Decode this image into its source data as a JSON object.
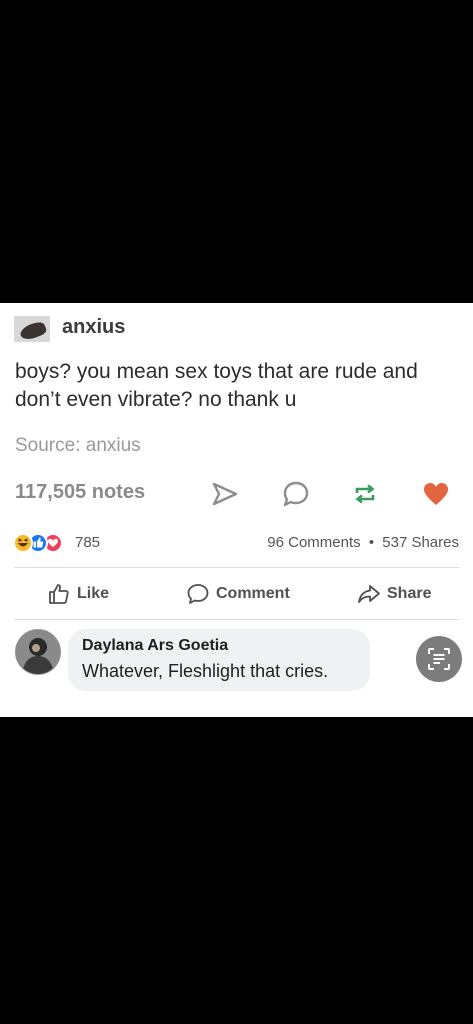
{
  "tumblr": {
    "username": "anxius",
    "post_text": "boys? you mean sex toys that are rude and don’t even vibrate? no thank u",
    "source": "Source: anxius",
    "notes": "117,505 notes"
  },
  "facebook": {
    "reaction_count": "785",
    "comments_count": "96 Comments",
    "separator": "•",
    "shares_count": "537 Shares",
    "like_label": "Like",
    "comment_label": "Comment",
    "share_label": "Share"
  },
  "comment": {
    "author": "Daylana Ars Goetia",
    "text": "Whatever, Fleshlight that cries."
  },
  "icons": {
    "send": "send-icon",
    "reply": "reply-icon",
    "reblog": "reblog-icon",
    "heart": "heart-icon",
    "like": "thumbs-up-icon",
    "comment": "comment-bubble-icon",
    "share": "share-arrow-icon",
    "lens": "visual-search-icon"
  },
  "colors": {
    "heart": "#e2653f",
    "reblog": "#3b9b5d",
    "like_reaction": "#1877f2",
    "love_reaction": "#f33e58",
    "haha_reaction": "#f7b928"
  }
}
